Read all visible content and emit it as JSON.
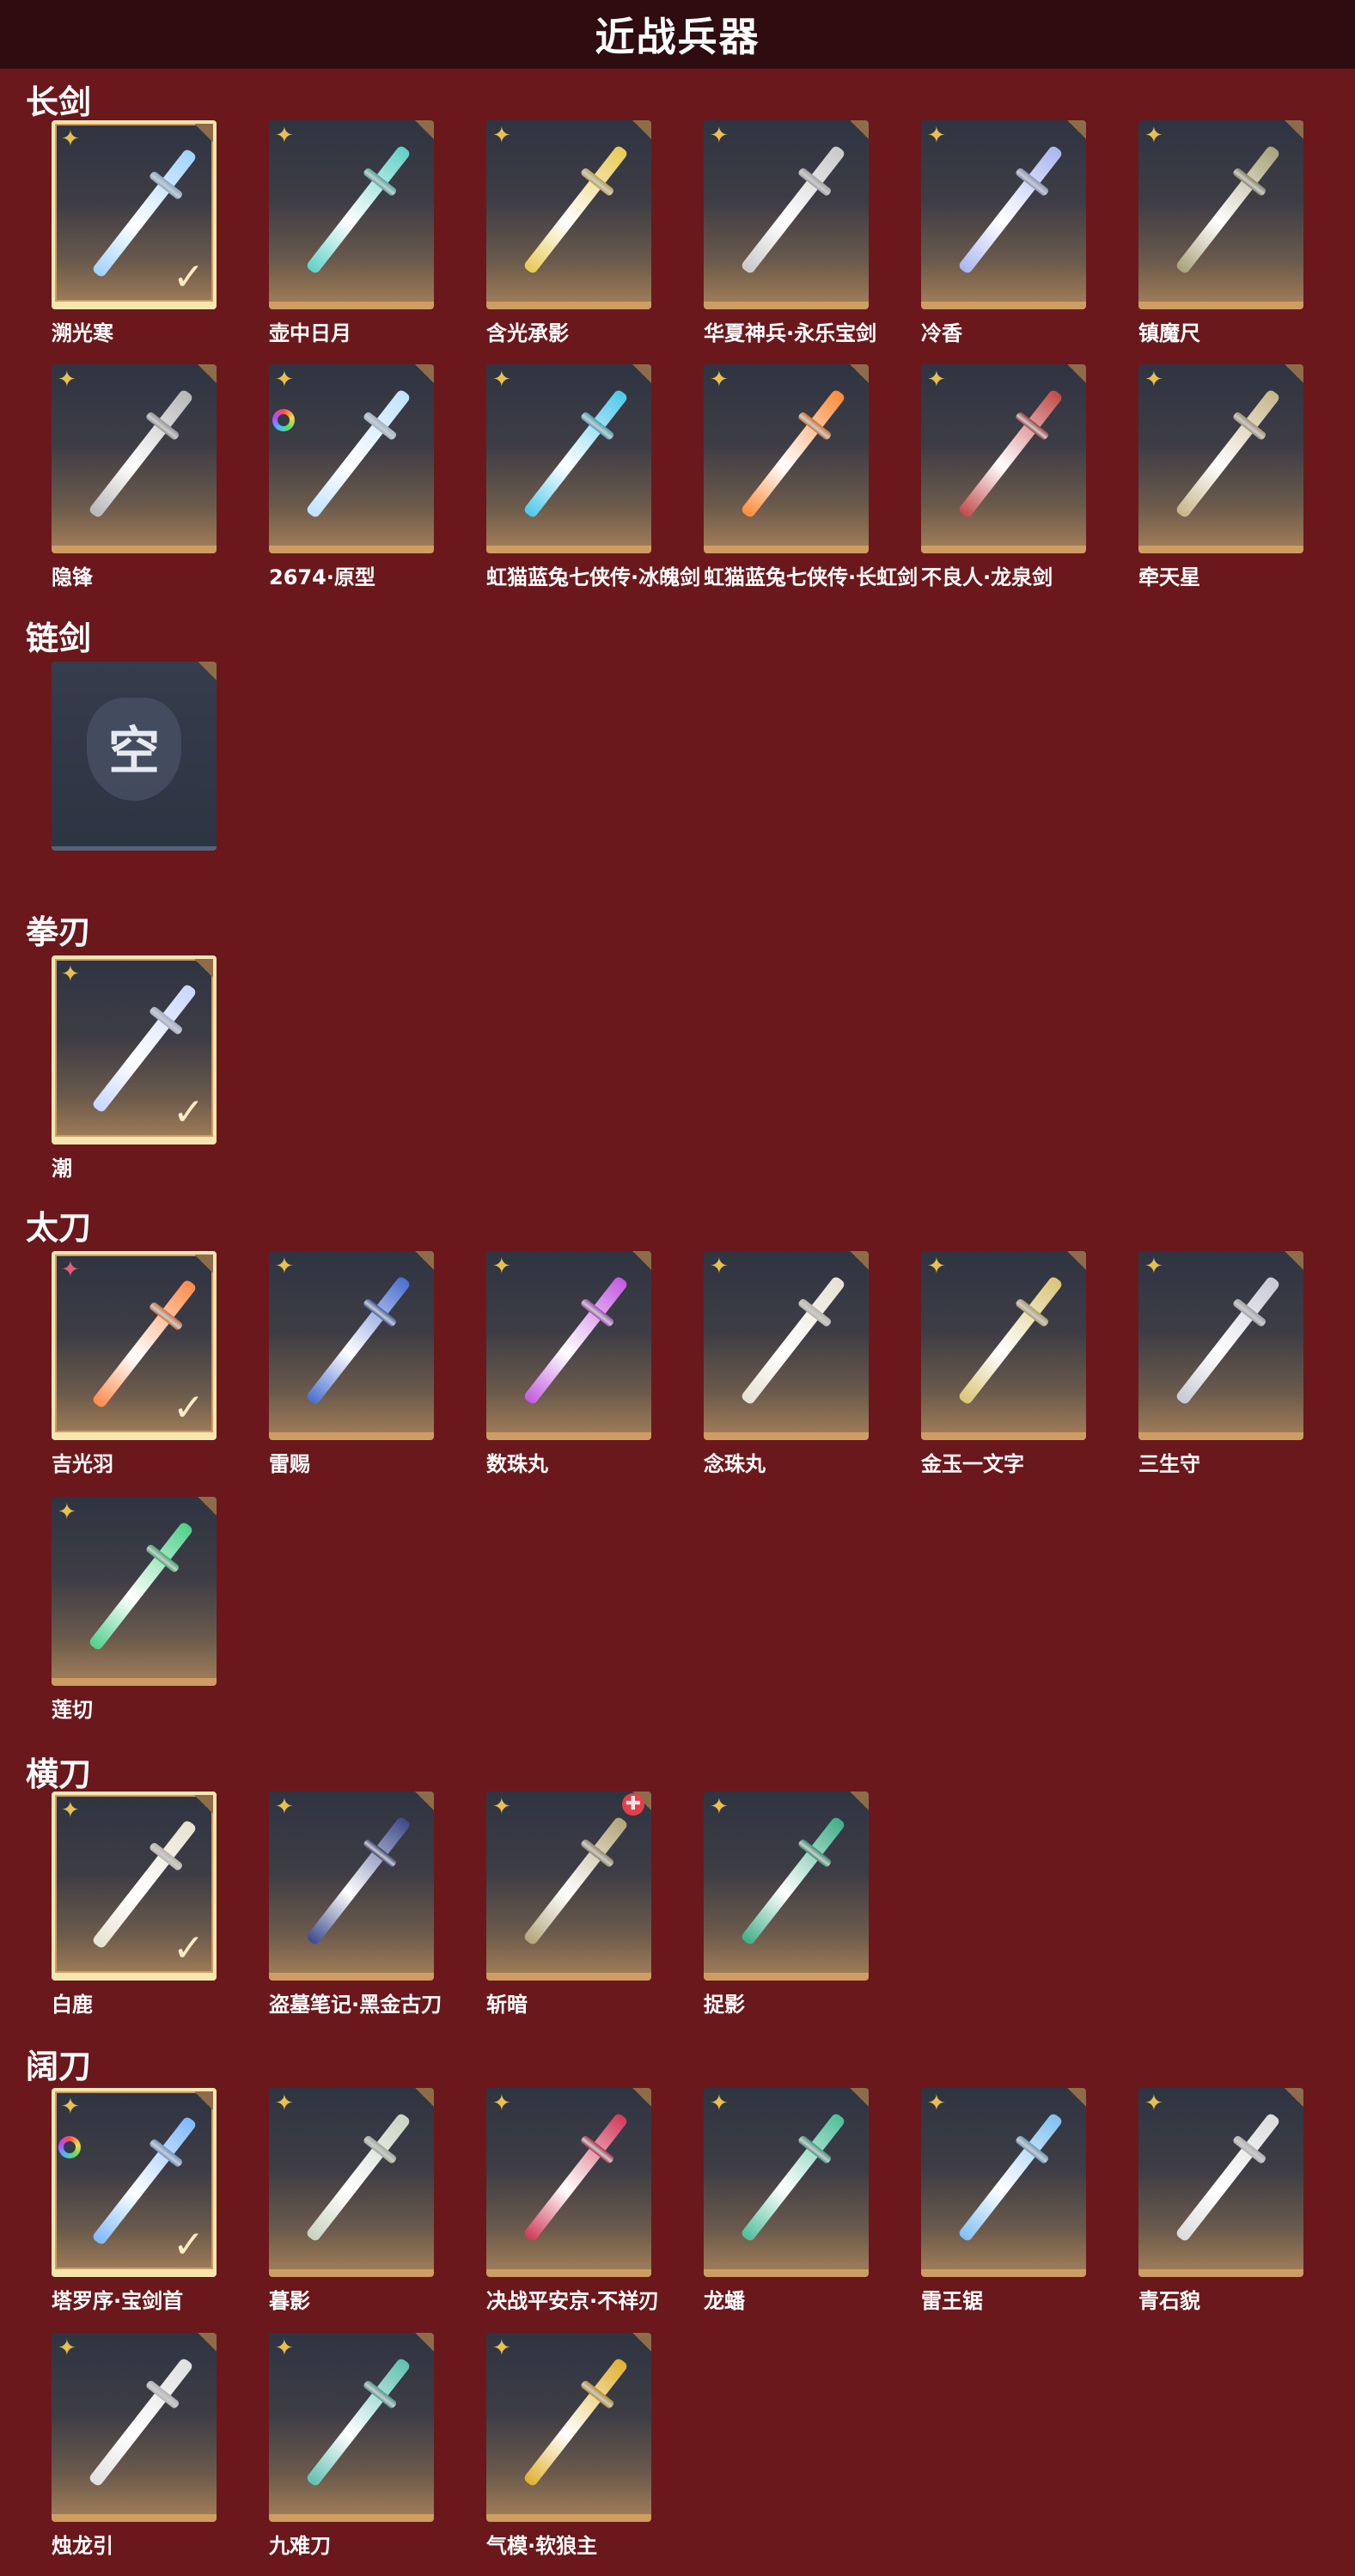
{
  "page_title": "近战兵器",
  "sections": [
    {
      "title": "长剑",
      "items": [
        {
          "name": "溯光寒",
          "badge": "star",
          "selected": true,
          "color": "#9fd2ff"
        },
        {
          "name": "壶中日月",
          "badge": "star",
          "color": "#5fd1c6"
        },
        {
          "name": "含光承影",
          "badge": "star",
          "color": "#e8c955"
        },
        {
          "name": "华夏神兵·永乐宝剑",
          "badge": "star",
          "color": "#c9c9c9"
        },
        {
          "name": "冷香",
          "badge": "star",
          "color": "#a9b6f0"
        },
        {
          "name": "镇魔尺",
          "badge": "star",
          "color": "#a7a27a"
        },
        {
          "name": "隐锋",
          "badge": "star",
          "color": "#b7b7b7"
        },
        {
          "name": "2674·原型",
          "badge": "star",
          "ring": true,
          "color": "#bfe2ff"
        },
        {
          "name": "虹猫蓝兔七侠传·冰魄剑",
          "badge": "star",
          "color": "#4fc8ea"
        },
        {
          "name": "虹猫蓝兔七侠传·长虹剑",
          "badge": "star",
          "color": "#ff8a3a"
        },
        {
          "name": "不良人·龙泉剑",
          "badge": "star",
          "color": "#c24a4a"
        },
        {
          "name": "牵天星",
          "badge": "star",
          "color": "#c7b58a"
        }
      ]
    },
    {
      "title": "链剑",
      "items": [
        {
          "name": "",
          "empty": true,
          "empty_label": "空"
        }
      ]
    },
    {
      "title": "拳刃",
      "items": [
        {
          "name": "潮",
          "badge": "star",
          "selected": true,
          "color": "#c8d6ff"
        }
      ]
    },
    {
      "title": "太刀",
      "items": [
        {
          "name": "吉光羽",
          "badge": "pink-star",
          "selected": true,
          "color": "#ff8a4a"
        },
        {
          "name": "雷赐",
          "badge": "star",
          "color": "#4a6fd0"
        },
        {
          "name": "数珠丸",
          "badge": "star",
          "color": "#c25be0"
        },
        {
          "name": "念珠丸",
          "badge": "star",
          "color": "#e7e1d3"
        },
        {
          "name": "金玉一文字",
          "badge": "star",
          "color": "#d9c478"
        },
        {
          "name": "三生守",
          "badge": "star",
          "color": "#c8c8d6"
        },
        {
          "name": "莲切",
          "badge": "star",
          "color": "#4fd08a"
        }
      ]
    },
    {
      "title": "横刀",
      "items": [
        {
          "name": "白鹿",
          "badge": "star",
          "selected": true,
          "color": "#e7e2d0"
        },
        {
          "name": "盗墓笔记·黑金古刀",
          "badge": "star",
          "color": "#3d4a8a"
        },
        {
          "name": "斩暗",
          "badge": "star",
          "cross": true,
          "color": "#b3a57a"
        },
        {
          "name": "捉影",
          "badge": "star",
          "color": "#3fae88"
        }
      ]
    },
    {
      "title": "阔刀",
      "items": [
        {
          "name": "塔罗序·宝剑首",
          "badge": "star",
          "ring": true,
          "selected": true,
          "color": "#7fb8ff"
        },
        {
          "name": "暮影",
          "badge": "star",
          "color": "#c9d3c0"
        },
        {
          "name": "决战平安京·不祥刃",
          "badge": "star",
          "color": "#d03a5a"
        },
        {
          "name": "龙蟠",
          "badge": "star",
          "color": "#4fbf9a"
        },
        {
          "name": "雷王锯",
          "badge": "star",
          "color": "#7fc0f0"
        },
        {
          "name": "青石貌",
          "badge": "star",
          "color": "#dcdcdc"
        },
        {
          "name": "烛龙引",
          "badge": "star",
          "color": "#e0e0e0"
        },
        {
          "name": "九难刀",
          "badge": "star",
          "color": "#5fc0b0"
        },
        {
          "name": "气模·软狼主",
          "badge": "star",
          "color": "#e0b030"
        }
      ]
    }
  ]
}
